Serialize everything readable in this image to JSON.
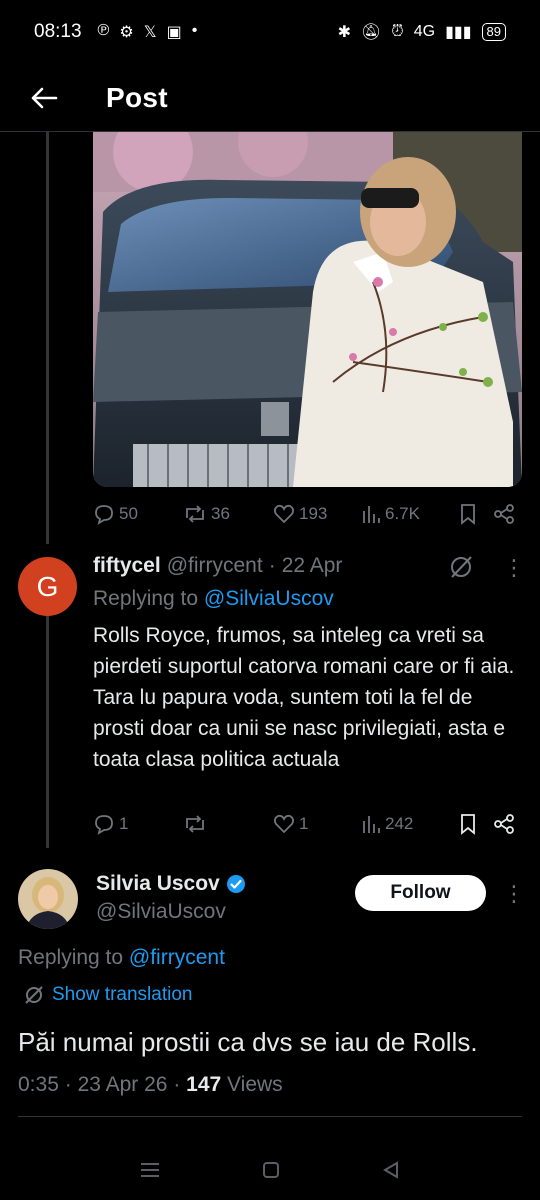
{
  "status_bar": {
    "time": "08:13",
    "battery": "89",
    "network": "4G"
  },
  "header": {
    "title": "Post"
  },
  "parent_post": {
    "stats": {
      "replies": "50",
      "reposts": "36",
      "likes": "193",
      "views": "6.7K"
    }
  },
  "reply": {
    "avatar_letter": "G",
    "display_name": "fiftycel",
    "handle": "@firrycent",
    "separator": "·",
    "date": "22 Apr",
    "replying_prefix": "Replying to",
    "replying_handle": "@SilviaUscov",
    "text": "Rolls Royce, frumos, sa inteleg ca vreti sa pierdeti suportul catorva romani care or fi aia. Tara lu papura voda, suntem toti la fel de prosti doar ca unii se nasc privilegiati, asta e toata clasa politica actuala",
    "stats": {
      "replies": "1",
      "reposts": "",
      "likes": "1",
      "views": "242"
    }
  },
  "main_post": {
    "display_name": "Silvia Uscov",
    "handle": "@SilviaUscov",
    "follow_label": "Follow",
    "replying_prefix": "Replying to",
    "replying_handle": "@firrycent",
    "show_translation": "Show translation",
    "text": "Păi numai prostii ca dvs se iau de Rolls.",
    "time": "0:35",
    "separator": "·",
    "date": "23 Apr 26",
    "views_count": "147",
    "views_label": "Views"
  },
  "colors": {
    "background": "#000000",
    "accent": "#1d9bf0",
    "muted": "#71767b",
    "avatar_g": "#d1411f"
  },
  "icons": [
    "back-arrow-icon",
    "reply-icon",
    "repost-icon",
    "like-icon",
    "views-icon",
    "bookmark-icon",
    "share-icon",
    "grok-icon",
    "more-icon",
    "verified-icon",
    "translate-icon"
  ]
}
